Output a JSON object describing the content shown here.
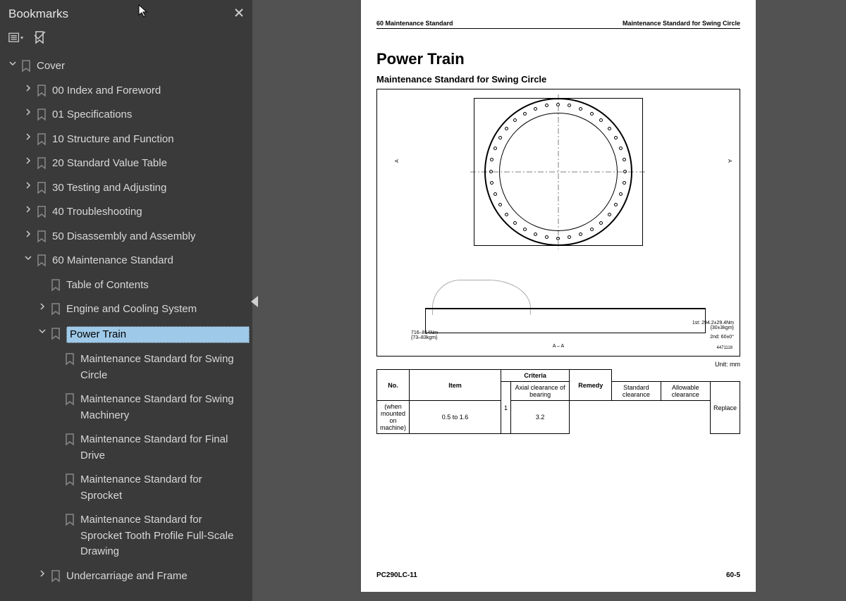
{
  "sidebar": {
    "title": "Bookmarks",
    "items": [
      {
        "level": 0,
        "chevron": "down",
        "label": "Cover"
      },
      {
        "level": 1,
        "chevron": "right",
        "label": "00 Index and Foreword"
      },
      {
        "level": 1,
        "chevron": "right",
        "label": "01 Specifications"
      },
      {
        "level": 1,
        "chevron": "right",
        "label": "10 Structure and Function"
      },
      {
        "level": 1,
        "chevron": "right",
        "label": "20 Standard Value Table"
      },
      {
        "level": 1,
        "chevron": "right",
        "label": "30 Testing and Adjusting"
      },
      {
        "level": 1,
        "chevron": "right",
        "label": "40 Troubleshooting"
      },
      {
        "level": 1,
        "chevron": "right",
        "label": "50 Disassembly and Assembly"
      },
      {
        "level": 1,
        "chevron": "down",
        "label": "60 Maintenance Standard"
      },
      {
        "level": 2,
        "chevron": "",
        "label": "Table of Contents"
      },
      {
        "level": 2,
        "chevron": "right",
        "label": "Engine and Cooling System"
      },
      {
        "level": 2,
        "chevron": "down",
        "label": "Power Train",
        "selected": true
      },
      {
        "level": 3,
        "chevron": "",
        "label": "Maintenance Standard for Swing Circle"
      },
      {
        "level": 3,
        "chevron": "",
        "label": "Maintenance Standard for Swing Machinery"
      },
      {
        "level": 3,
        "chevron": "",
        "label": "Maintenance Standard for Final Drive"
      },
      {
        "level": 3,
        "chevron": "",
        "label": "Maintenance Standard for Sprocket"
      },
      {
        "level": 3,
        "chevron": "",
        "label": "Maintenance Standard for Sprocket Tooth Profile Full-Scale Drawing"
      },
      {
        "level": 2,
        "chevron": "right",
        "label": "Undercarriage and Frame"
      }
    ]
  },
  "page": {
    "header_left": "60 Maintenance Standard",
    "header_right": "Maintenance Standard for Swing Circle",
    "h1": "Power Train",
    "h2": "Maintenance Standard for Swing Circle",
    "unit_label": "Unit: mm",
    "section_annot_left": "716–814Nm\n{73–83kgm}",
    "section_annot_right1": "1st: 294.2±29.4Nm\n{30±3kgm}",
    "section_annot_right2": "2nd: 60±0°",
    "section_label": "A – A",
    "diagram_id": "4471118",
    "table": {
      "headers": [
        "No.",
        "Item",
        "Criteria",
        "Remedy"
      ],
      "sub_headers": [
        "Standard clearance",
        "Allowable clearance"
      ],
      "row": {
        "no": "1",
        "item_line1": "Axial clearance of bearing",
        "item_line2": "(when mounted on machine)",
        "std": "0.5 to 1.6",
        "allow": "3.2",
        "remedy": "Replace"
      }
    },
    "footer_left": "PC290LC-11",
    "footer_right": "60-5"
  }
}
